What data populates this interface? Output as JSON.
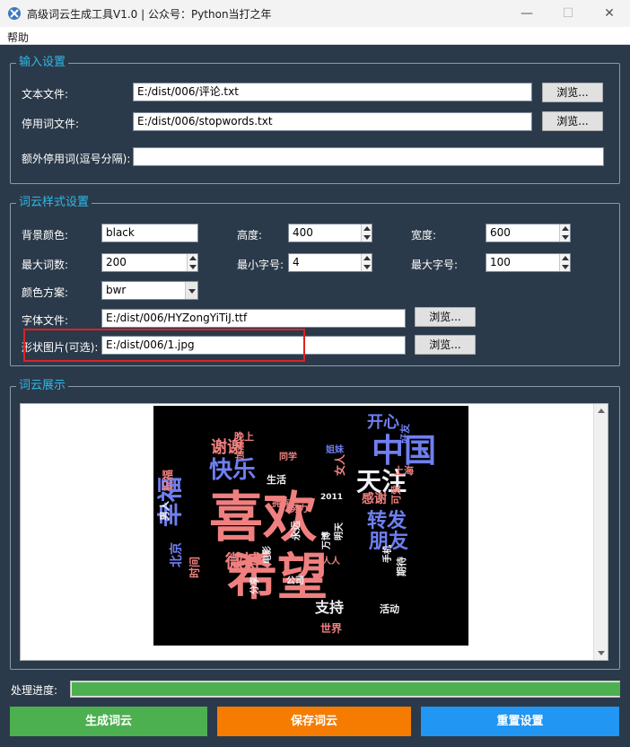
{
  "window": {
    "title": "高级词云生成工具V1.0 | 公众号：Python当打之年",
    "minimize": "—",
    "maximize": "☐",
    "close": "✕"
  },
  "menu": {
    "help": "帮助"
  },
  "input_settings": {
    "title": "输入设置",
    "text_file_label": "文本文件:",
    "text_file_value": "E:/dist/006/评论.txt",
    "stopwords_label": "停用词文件:",
    "stopwords_value": "E:/dist/006/stopwords.txt",
    "extra_stopwords_label": "额外停用词(逗号分隔):",
    "extra_stopwords_value": "",
    "browse": "浏览..."
  },
  "style_settings": {
    "title": "词云样式设置",
    "bg_color_label": "背景颜色:",
    "bg_color_value": "black",
    "height_label": "高度:",
    "height_value": "400",
    "width_label": "宽度:",
    "width_value": "600",
    "max_words_label": "最大词数:",
    "max_words_value": "200",
    "min_font_label": "最小字号:",
    "min_font_value": "4",
    "max_font_label": "最大字号:",
    "max_font_value": "100",
    "colormap_label": "颜色方案:",
    "colormap_value": "bwr",
    "font_file_label": "字体文件:",
    "font_file_value": "E:/dist/006/HYZongYiTiJ.ttf",
    "mask_label": "形状图片(可选):",
    "mask_value": "E:/dist/006/1.jpg",
    "browse": "浏览..."
  },
  "display": {
    "title": "词云展示",
    "words": [
      {
        "text": "喜欢",
        "color": "#f08080"
      },
      {
        "text": "希望",
        "color": "#f08080"
      },
      {
        "text": "中国",
        "color": "#6f7ff0"
      },
      {
        "text": "天注",
        "color": "#f0f0f5"
      },
      {
        "text": "快乐",
        "color": "#6f7ff0"
      },
      {
        "text": "幸福",
        "color": "#6f7ff0"
      },
      {
        "text": "转发",
        "color": "#6f7ff0"
      },
      {
        "text": "朋友",
        "color": "#6f7ff0"
      },
      {
        "text": "微博",
        "color": "#f08080"
      },
      {
        "text": "支持",
        "color": "#f0f0f5"
      },
      {
        "text": "谢谢",
        "color": "#f08080"
      },
      {
        "text": "开心",
        "color": "#6f7ff0"
      },
      {
        "text": "感谢",
        "color": "#f08080"
      },
      {
        "text": "北京",
        "color": "#6f7ff0"
      },
      {
        "text": "时间",
        "color": "#f08080"
      },
      {
        "text": "世界",
        "color": "#f08080"
      },
      {
        "text": "女人",
        "color": "#f08080"
      },
      {
        "text": "男人",
        "color": "#f0f0f5"
      },
      {
        "text": "生活",
        "color": "#f0f0f5"
      },
      {
        "text": "上海",
        "color": "#f08080"
      },
      {
        "text": "活动",
        "color": "#f0f0f5"
      },
      {
        "text": "永远",
        "color": "#f0f0f5"
      },
      {
        "text": "祝福",
        "color": "#f08080"
      },
      {
        "text": "晚上",
        "color": "#f08080"
      },
      {
        "text": "期待",
        "color": "#f0f0f5"
      },
      {
        "text": "可爱",
        "color": "#f08080"
      },
      {
        "text": "电影",
        "color": "#f0f0f5"
      },
      {
        "text": "分享",
        "color": "#f0f0f5"
      },
      {
        "text": "努力",
        "color": "#f08080"
      },
      {
        "text": "明天",
        "color": "#f0f0f5"
      },
      {
        "text": "拥有",
        "color": "#f08080"
      },
      {
        "text": "万博",
        "color": "#f0f0f5"
      },
      {
        "text": "公司",
        "color": "#f0f0f5"
      },
      {
        "text": "人人",
        "color": "#f08080"
      },
      {
        "text": "手机",
        "color": "#f0f0f5"
      },
      {
        "text": "好友",
        "color": "#6f7ff0"
      },
      {
        "text": "同学",
        "color": "#f08080"
      },
      {
        "text": "姐妹",
        "color": "#6f7ff0"
      },
      {
        "text": "2011",
        "color": "#f0f0f5"
      },
      {
        "text": "加油",
        "color": "#f08080"
      }
    ]
  },
  "progress": {
    "label": "处理进度:",
    "value": 1.0,
    "color": "#4caf50"
  },
  "actions": {
    "generate": "生成词云",
    "save": "保存词云",
    "reset": "重置设置",
    "generate_color": "#4caf50",
    "save_color": "#f57c00",
    "reset_color": "#2196f3"
  },
  "theme": {
    "background": "#2b3a4a",
    "accent": "#2eb8e6"
  }
}
